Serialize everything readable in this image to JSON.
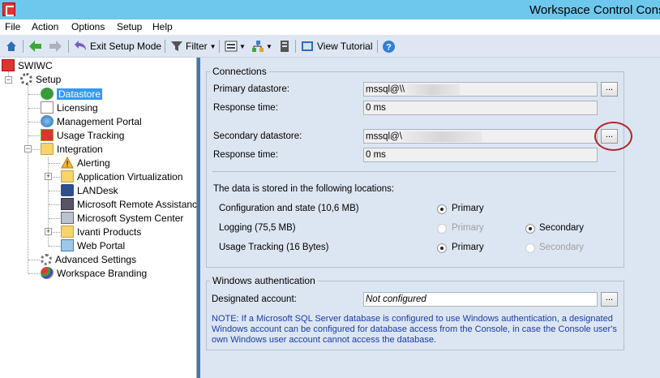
{
  "window": {
    "title": "Workspace Control Cons"
  },
  "menu": [
    "File",
    "Action",
    "Options",
    "Setup",
    "Help"
  ],
  "toolbar": {
    "exit_setup": "Exit Setup Mode",
    "filter": "Filter",
    "view_tutorial": "View Tutorial"
  },
  "tree": {
    "root": "SWIWC",
    "setup": "Setup",
    "items": {
      "datastore": "Datastore",
      "licensing": "Licensing",
      "management_portal": "Management Portal",
      "usage_tracking": "Usage Tracking",
      "integration": "Integration",
      "alerting": "Alerting",
      "app_virtualization": "Application Virtualization",
      "landesk": "LANDesk",
      "ms_remote": "Microsoft Remote Assistance",
      "ms_system_center": "Microsoft System Center",
      "ivanti": "Ivanti Products",
      "web_portal": "Web Portal",
      "advanced": "Advanced Settings",
      "branding": "Workspace Branding"
    }
  },
  "connections": {
    "title": "Connections",
    "primary_label": "Primary datastore:",
    "primary_value": "mssql@\\\\",
    "response1_label": "Response time:",
    "response1_value": "0 ms",
    "secondary_label": "Secondary datastore:",
    "secondary_value": "mssql@\\",
    "response2_label": "Response time:",
    "response2_value": "0 ms",
    "browse": "...",
    "stored_heading": "The data is stored in the following locations:",
    "rows": {
      "config": "Configuration and state (10,6 MB)",
      "logging": "Logging (75,5 MB)",
      "usage": "Usage Tracking (16 Bytes)"
    },
    "primary_opt": "Primary",
    "secondary_opt": "Secondary"
  },
  "winauth": {
    "title": "Windows authentication",
    "account_label": "Designated account:",
    "account_value": "Not configured",
    "note": "NOTE: If a Microsoft SQL Server database is configured to use Windows authentication, a designated Windows account can be configured for database access from the Console, in case the Console user's own Windows user account cannot access the database."
  }
}
